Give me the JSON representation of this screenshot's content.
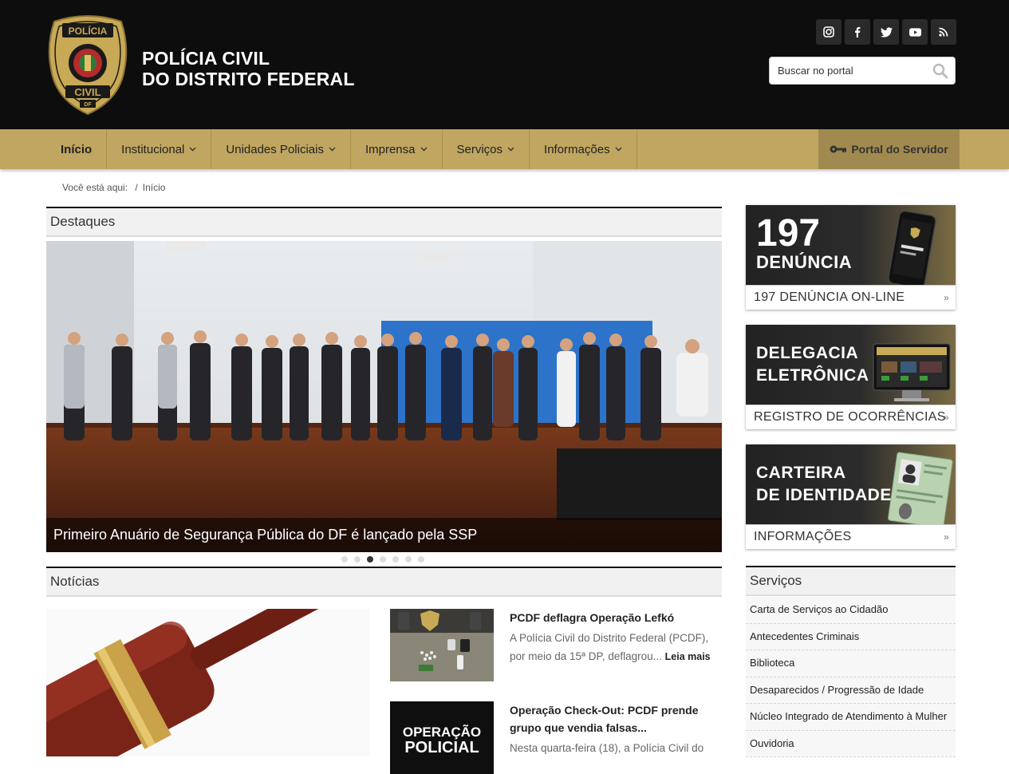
{
  "header": {
    "badge_top": "POLÍCIA",
    "badge_mid": "CIVIL",
    "badge_bottom": "DF",
    "title_line1": "POLÍCIA CIVIL",
    "title_line2": "DO DISTRITO FEDERAL",
    "social": [
      "instagram-icon",
      "facebook-icon",
      "twitter-icon",
      "youtube-icon",
      "rss-icon"
    ],
    "search_placeholder": "Buscar no portal"
  },
  "nav": {
    "items": [
      {
        "label": "Início",
        "active": true,
        "dropdown": false
      },
      {
        "label": "Institucional",
        "dropdown": true
      },
      {
        "label": "Unidades Policiais",
        "dropdown": true
      },
      {
        "label": "Imprensa",
        "dropdown": true
      },
      {
        "label": "Serviços",
        "dropdown": true
      },
      {
        "label": "Informações",
        "dropdown": true
      }
    ],
    "portal_label": "Portal do Servidor"
  },
  "breadcrumb": {
    "prefix": "Você está aqui:",
    "current": "Início"
  },
  "highlights": {
    "heading": "Destaques",
    "caption": "Primeiro Anuário de Segurança Pública do DF é lançado pela SSP",
    "dots": 7,
    "active_dot": 3
  },
  "news": {
    "heading": "Notícias",
    "items": [
      {
        "title": "PCDF deflagra Operação Lefkó",
        "excerpt": "A Polícia Civil do Distrito Federal (PCDF), por meio da 15ª DP, deflagrou...",
        "more": "Leia mais"
      },
      {
        "title": "Operação Check-Out: PCDF prende grupo que vendia falsas...",
        "excerpt": "Nesta quarta-feira (18), a Polícia Civil do"
      }
    ],
    "thumb2_text_line1": "OPERAÇÃO",
    "thumb2_text_line2": "POLICIAL"
  },
  "sidebar": {
    "banners": [
      {
        "big1": "197",
        "big2": "DENÚNCIA",
        "bottom": "197 DENÚNCIA ON-LINE"
      },
      {
        "big1": "DELEGACIA",
        "big2": "ELETRÔNICA",
        "bottom": "REGISTRO DE OCORRÊNCIAS"
      },
      {
        "big1": "CARTEIRA",
        "big2": "DE IDENTIDADE",
        "bottom": "INFORMAÇÕES"
      }
    ],
    "services_heading": "Serviços",
    "services": [
      "Carta de Serviços ao Cidadão",
      "Antecedentes Criminais",
      "Biblioteca",
      "Desaparecidos / Progressão de Idade",
      "Núcleo Integrado de Atendimento à Mulher",
      "Ouvidoria"
    ]
  },
  "colors": {
    "header_bg": "#0d0d0d",
    "nav_gold": "#c0a660",
    "portal_bg": "#a08a4f",
    "badge_gold": "#c8a955"
  }
}
